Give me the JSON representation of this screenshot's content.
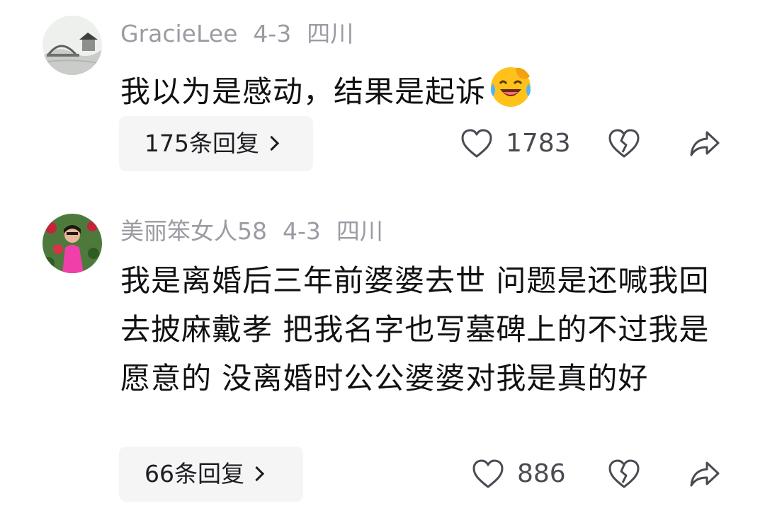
{
  "comments": [
    {
      "username": "GracieLee",
      "date": "4-3",
      "location": "四川",
      "text": "我以为是感动，结果是起诉",
      "emoji": "laughing-crying-emoji",
      "replies_label": "175条回复",
      "likes": "1783"
    },
    {
      "username": "美丽笨女人58",
      "date": "4-3",
      "location": "四川",
      "text": "我是离婚后三年前婆婆去世 问题是还喊我回去披麻戴孝 把我名字也写墓碑上的不过我是愿意的 没离婚时公公婆婆对我是真的好",
      "replies_label": "66条回复",
      "likes": "886"
    }
  ],
  "icons": {
    "like": "heart-outline-icon",
    "dislike": "broken-heart-icon",
    "share": "share-arrow-icon",
    "chevron": "chevron-right-icon"
  },
  "colors": {
    "meta_text": "#9b9ba3",
    "body_text": "#111114",
    "reply_bg": "#f5f5f6",
    "icon": "#4a4a52"
  }
}
